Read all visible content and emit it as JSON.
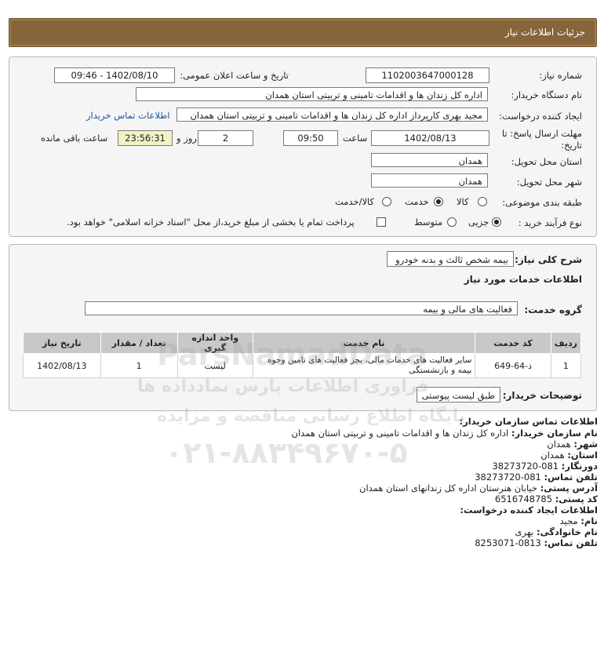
{
  "header": {
    "title": "جزئیات اطلاعات نیاز"
  },
  "form": {
    "need_number_label": "شماره نیاز:",
    "need_number": "1102003647000128",
    "announce_label": "تاریخ و ساعت اعلان عمومی:",
    "announce_value": "1402/08/10 - 09:46",
    "buyer_org_label": "نام دستگاه خریدار:",
    "buyer_org": "اداره کل زندان ها و اقدامات تامینی و تربیتی استان همدان",
    "creator_label": "ایجاد کننده درخواست:",
    "creator": "مجید بهری کارپرداز اداره کل زندان ها و اقدامات تامینی و تربیتی استان همدان",
    "buyer_contact_link": "اطلاعات تماس خریدار",
    "deadline_label": "مهلت ارسال پاسخ: تا تاریخ:",
    "deadline_date": "1402/08/13",
    "time_label": "ساعت",
    "deadline_time": "09:50",
    "days_value": "2",
    "days_label": "روز و",
    "remaining_time": "23:56:31",
    "remaining_label": "ساعت باقی مانده",
    "province_label": "استان محل تحویل:",
    "province": "همدان",
    "city_label": "شهر محل تحویل:",
    "city": "همدان",
    "category_label": "طبقه بندی موضوعی:",
    "category_options": [
      "کالا",
      "خدمت",
      "کالا/خدمت"
    ],
    "category_selected": "خدمت",
    "process_label": "نوع فرآیند خرید :",
    "process_options": [
      "جزیی",
      "متوسط"
    ],
    "process_selected": "جزیی",
    "payment_note": "پرداخت تمام یا بخشی از مبلغ خرید،از محل \"اسناد خزانه اسلامی\" خواهد بود."
  },
  "details": {
    "general_desc_label": "شرح کلی نیاز:",
    "general_desc": "بیمه شخص ثالث و بدنه خودرو",
    "services_title": "اطلاعات خدمات مورد نیاز",
    "service_group_label": "گروه خدمت:",
    "service_group": "فعالیت  های مالی و بیمه",
    "table_headers": [
      "ردیف",
      "کد خدمت",
      "نام خدمت",
      "واحد اندازه گیری",
      "تعداد / مقدار",
      "تاریخ نیاز"
    ],
    "table_rows": [
      {
        "row": "1",
        "code": "ذ-64-649",
        "name": "سایر فعالیت های خدمات مالی، بجز فعالیت های تامین وجوه بیمه و بازنشستگی",
        "unit": "لیست",
        "qty": "1",
        "date": "1402/08/13"
      }
    ],
    "buyer_notes_label": "توضیحات خریدار:",
    "buyer_notes": "طبق لیست پیوستی"
  },
  "contact": {
    "title": "اطلاعات تماس سازمان خریدار:",
    "org_name_label": "نام سازمان خریدار:",
    "org_name": "اداره کل زندان ها و اقدامات تامینی و تربیتی استان همدان",
    "city_label": "شهر:",
    "city": "همدان",
    "province_label": "استان:",
    "province": "همدان",
    "fax_label": "دورنگار:",
    "fax": "081-38273720",
    "phone_label": "تلفن تماس:",
    "phone": "081-38273720",
    "address_label": "آدرس پستی:",
    "address": "خیابان هنرستان اداره کل زندانهای استان همدان",
    "postal_label": "کد پستی:",
    "postal": "6516748785",
    "creator_title": "اطلاعات ایجاد کننده درخواست:",
    "first_name_label": "نام:",
    "first_name": "مجید",
    "last_name_label": "نام خانوادگی:",
    "last_name": "بهری",
    "creator_phone_label": "تلفن تماس:",
    "creator_phone": "0813-8253071"
  },
  "watermark": {
    "site": "ParsNamadData",
    "line1": "پایگاه اطلاع رسانی مناقصه و مزایده",
    "phone": "۰۲۱-۸۸۳۴۹۶۷۰-۵",
    "brand": "فراوری اطلاعات پارس نمادداده ها"
  }
}
